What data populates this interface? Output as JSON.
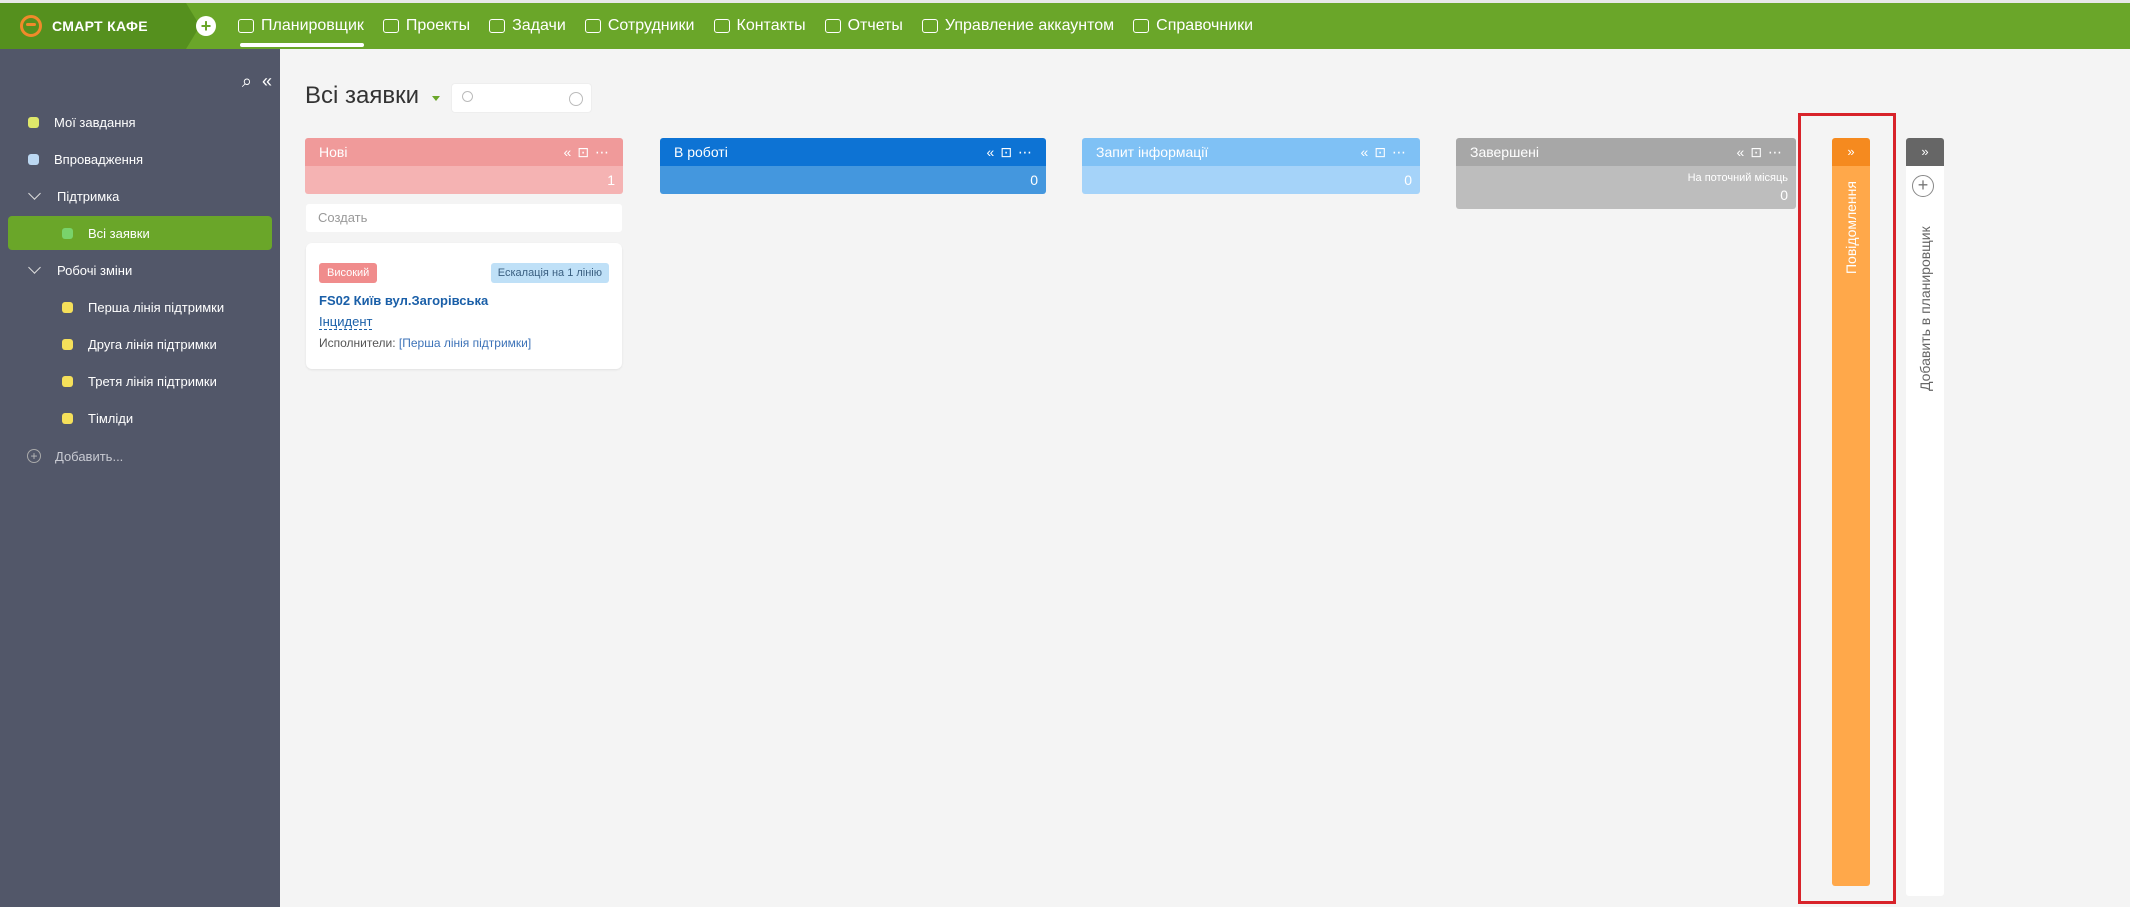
{
  "app": {
    "brand": "СМАРТ КАФЕ"
  },
  "nav": [
    {
      "label": "Планировщик",
      "icon": "planner-icon",
      "active": true
    },
    {
      "label": "Проекты",
      "icon": "projects-icon"
    },
    {
      "label": "Задачи",
      "icon": "tasks-icon"
    },
    {
      "label": "Сотрудники",
      "icon": "people-icon"
    },
    {
      "label": "Контакты",
      "icon": "contacts-icon"
    },
    {
      "label": "Отчеты",
      "icon": "reports-icon"
    },
    {
      "label": "Управление аккаунтом",
      "icon": "account-icon"
    },
    {
      "label": "Справочники",
      "icon": "directory-icon"
    }
  ],
  "sidebar": {
    "items": [
      {
        "label": "Мої завдання",
        "color": "#dfe86a"
      },
      {
        "label": "Впровадження",
        "color": "#bcd8f2"
      },
      {
        "label": "Підтримка"
      },
      {
        "label": "Всі заявки",
        "color": "#79d36b"
      },
      {
        "label": "Робочі зміни"
      },
      {
        "label": "Перша лінія підтримки",
        "color": "#f5e05a"
      },
      {
        "label": "Друга лінія підтримки",
        "color": "#f5e05a"
      },
      {
        "label": "Третя лінія підтримки",
        "color": "#f5e05a"
      },
      {
        "label": "Тімліди",
        "color": "#f5e05a"
      }
    ],
    "add_label": "Добавить..."
  },
  "main": {
    "title": "Всі заявки",
    "columns": [
      {
        "name": "Нові",
        "count": "1",
        "head_color": "#f09a9a",
        "sub_color": "#f5b3b3"
      },
      {
        "name": "В роботі",
        "count": "0",
        "head_color": "#0d73d4",
        "sub_color": "#4497de"
      },
      {
        "name": "Запит інформації",
        "count": "0",
        "head_color": "#7fc1f5",
        "sub_color": "#a5d3f9"
      },
      {
        "name": "Завершені",
        "count": "0",
        "period": "На поточний місяць",
        "head_color": "#a7a7a7",
        "sub_color": "#bdbdbd"
      }
    ],
    "create_label": "Создать",
    "card": {
      "priority": "Високий",
      "escalation": "Ескалація на 1 лінію",
      "title": "FS02 Київ вул.Загорівська",
      "type": "Інцидент",
      "executors_label": "Исполнители:",
      "executors_value": "[Перша лінія підтримки]"
    },
    "notifications_label": "Повідомлення",
    "add_planner_label": "Добавить в планировщик",
    "collapse_glyph": "»"
  }
}
